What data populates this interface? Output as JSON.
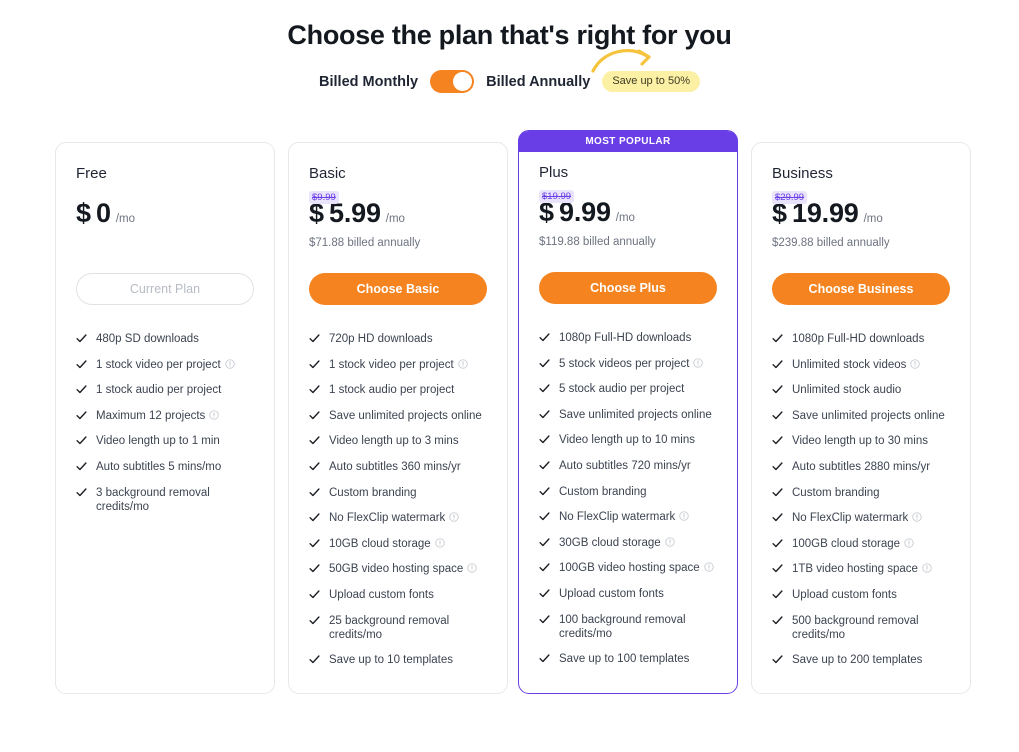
{
  "header": {
    "title": "Choose the plan that's right for you"
  },
  "billing": {
    "monthly_label": "Billed Monthly",
    "annually_label": "Billed Annually",
    "toggle_state": "annually",
    "save_badge": "Save up to 50%",
    "colors": {
      "toggle_track": "#f5831f",
      "toggle_knob": "#ffffff",
      "badge_bg": "#fcf0a5",
      "arrow": "#f6c33d"
    }
  },
  "colors": {
    "accent_orange": "#f5831f",
    "accent_purple": "#6a3ee6",
    "old_price_bg": "#e9e3fb",
    "card_border": "#e6e8ec",
    "text_dark": "#1f2533",
    "text_muted": "#6d7380"
  },
  "plans": [
    {
      "name": "Free",
      "currency": "$",
      "price": "0",
      "period": "/mo",
      "old_price": "",
      "billed_note": "",
      "cta_label": "Current Plan",
      "cta_state": "disabled",
      "popular": false,
      "badge": "",
      "features": [
        {
          "text": "480p SD downloads",
          "info": false
        },
        {
          "text": "1 stock video per project",
          "info": true
        },
        {
          "text": "1 stock audio per project",
          "info": false
        },
        {
          "text": "Maximum 12 projects",
          "info": true
        },
        {
          "text": "Video length up to 1 min",
          "info": false
        },
        {
          "text": "Auto subtitles 5 mins/mo",
          "info": false
        },
        {
          "text": "3 background removal credits/mo",
          "info": false
        }
      ]
    },
    {
      "name": "Basic",
      "currency": "$",
      "price": "5.99",
      "period": "/mo",
      "old_price": "$9.99",
      "billed_note": "$71.88 billed annually",
      "cta_label": "Choose Basic",
      "cta_state": "active",
      "popular": false,
      "badge": "",
      "features": [
        {
          "text": "720p HD downloads",
          "info": false
        },
        {
          "text": "1 stock video per project",
          "info": true
        },
        {
          "text": "1 stock audio per project",
          "info": false
        },
        {
          "text": "Save unlimited projects online",
          "info": false
        },
        {
          "text": "Video length up to 3 mins",
          "info": false
        },
        {
          "text": "Auto subtitles 360 mins/yr",
          "info": false
        },
        {
          "text": "Custom branding",
          "info": false
        },
        {
          "text": "No FlexClip watermark",
          "info": true
        },
        {
          "text": "10GB cloud storage",
          "info": true
        },
        {
          "text": "50GB video hosting space",
          "info": true
        },
        {
          "text": "Upload custom fonts",
          "info": false
        },
        {
          "text": "25 background removal credits/mo",
          "info": false
        },
        {
          "text": "Save up to 10 templates",
          "info": false
        }
      ]
    },
    {
      "name": "Plus",
      "currency": "$",
      "price": "9.99",
      "period": "/mo",
      "old_price": "$19.99",
      "billed_note": "$119.88 billed annually",
      "cta_label": "Choose Plus",
      "cta_state": "active",
      "popular": true,
      "badge": "MOST POPULAR",
      "features": [
        {
          "text": "1080p Full-HD downloads",
          "info": false
        },
        {
          "text": "5 stock videos per project",
          "info": true
        },
        {
          "text": "5 stock audio per project",
          "info": false
        },
        {
          "text": "Save unlimited projects online",
          "info": false
        },
        {
          "text": "Video length up to 10 mins",
          "info": false
        },
        {
          "text": "Auto subtitles 720 mins/yr",
          "info": false
        },
        {
          "text": "Custom branding",
          "info": false
        },
        {
          "text": "No FlexClip watermark",
          "info": true
        },
        {
          "text": "30GB cloud storage",
          "info": true
        },
        {
          "text": "100GB video hosting space",
          "info": true
        },
        {
          "text": "Upload custom fonts",
          "info": false
        },
        {
          "text": "100 background removal credits/mo",
          "info": false
        },
        {
          "text": "Save up to 100 templates",
          "info": false
        }
      ]
    },
    {
      "name": "Business",
      "currency": "$",
      "price": "19.99",
      "period": "/mo",
      "old_price": "$29.99",
      "billed_note": "$239.88 billed annually",
      "cta_label": "Choose Business",
      "cta_state": "active",
      "popular": false,
      "badge": "",
      "features": [
        {
          "text": "1080p Full-HD downloads",
          "info": false
        },
        {
          "text": "Unlimited stock videos",
          "info": true
        },
        {
          "text": "Unlimited stock audio",
          "info": false
        },
        {
          "text": "Save unlimited projects online",
          "info": false
        },
        {
          "text": "Video length up to 30 mins",
          "info": false
        },
        {
          "text": "Auto subtitles 2880 mins/yr",
          "info": false
        },
        {
          "text": "Custom branding",
          "info": false
        },
        {
          "text": "No FlexClip watermark",
          "info": true
        },
        {
          "text": "100GB cloud storage",
          "info": true
        },
        {
          "text": "1TB video hosting space",
          "info": true
        },
        {
          "text": "Upload custom fonts",
          "info": false
        },
        {
          "text": "500 background removal credits/mo",
          "info": false
        },
        {
          "text": "Save up to 200 templates",
          "info": false
        }
      ]
    }
  ]
}
